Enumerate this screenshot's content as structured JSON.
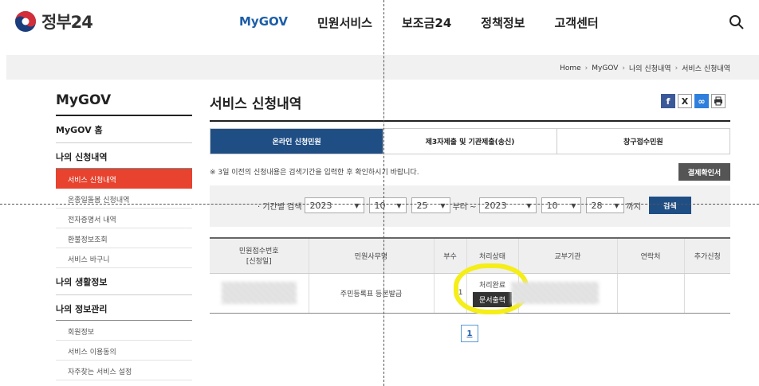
{
  "header": {
    "logo_text": "정부24",
    "nav": [
      "MyGOV",
      "민원서비스",
      "보조금24",
      "정책정보",
      "고객센터"
    ]
  },
  "breadcrumb": [
    "Home",
    "MyGOV",
    "나의 신청내역",
    "서비스 신청내역"
  ],
  "sidebar": {
    "title": "MyGOV",
    "home": "MyGOV 홈",
    "group1": "나의 신청내역",
    "group1_items": [
      "서비스 신청내역",
      "온종일돌봄 신청내역",
      "전자증명서 내역",
      "환불정보조회",
      "서비스 바구니"
    ],
    "group2": "나의 생활정보",
    "group3": "나의 정보관리",
    "group3_items": [
      "회원정보",
      "서비스 이용동의",
      "자주찾는 서비스 설정"
    ]
  },
  "main": {
    "title": "서비스 신청내역",
    "tabs": [
      "온라인 신청민원",
      "제3자제출 및 기관제출(송신)",
      "창구접수민원"
    ],
    "notice": "※ 3일 이전의 신청내용은 검색기간을 입력한 후 확인하시기 바랍니다.",
    "receipt_button": "결제확인서",
    "search": {
      "label": "· 기간별 검색",
      "from_year": "2023",
      "from_month": "10",
      "from_day": "25",
      "from_text": "부터 ~",
      "to_year": "2023",
      "to_month": "10",
      "to_day": "28",
      "to_text": "까지",
      "submit": "검색"
    },
    "table": {
      "headers": [
        "민원접수번호\n[신청일]",
        "민원사무명",
        "부수",
        "처리상태",
        "교부기관",
        "연락처",
        "추가신청"
      ],
      "rows": [
        {
          "service_name": "주민등록표 등본발급",
          "copies": "1",
          "status": "처리완료",
          "print_button": "문서출력"
        }
      ]
    },
    "pagination": [
      "1"
    ]
  },
  "colors": {
    "brand_blue": "#1f4e85",
    "active_red": "#e7432f",
    "highlight": "#f5ee18"
  }
}
